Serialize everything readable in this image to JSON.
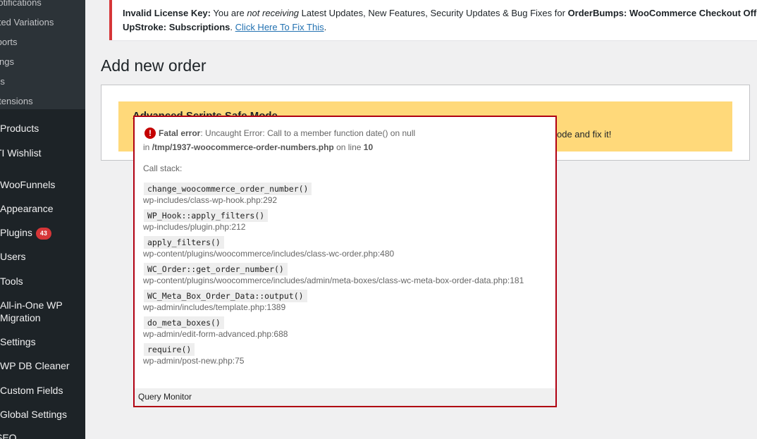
{
  "sidebar": {
    "submenu": [
      "Notifications",
      "Limited Variations",
      "Reports",
      "Settings",
      "Status",
      "Extensions"
    ],
    "menu": [
      {
        "label": "Products"
      },
      {
        "label": "TI Wishlist"
      },
      {
        "label": "WooFunnels"
      },
      {
        "label": "Appearance"
      },
      {
        "label": "Plugins",
        "badge": "43"
      },
      {
        "label": "Users"
      },
      {
        "label": "Tools"
      },
      {
        "label": "All-in-One WP",
        "label2": "Migration"
      },
      {
        "label": "Settings"
      },
      {
        "label": "WP DB Cleaner"
      },
      {
        "label": "Custom Fields"
      },
      {
        "label": "Global Settings"
      },
      {
        "label": "SEO"
      }
    ]
  },
  "license_notice": {
    "prefix": "Invalid License Key:",
    "text1": " You are ",
    "emphasis": "not receiving",
    "text2": " Latest Updates, New Features, Security Updates & Bug Fixes for ",
    "product1": "OrderBumps: WooCommerce Checkout Offers",
    "text3": ",",
    "product2": "UpStroke: Subscriptions",
    "text4": ". ",
    "link": "Click Here To Fix This",
    "text5": "."
  },
  "page_title": "Add new order",
  "yellow_notice": {
    "title": "Advanced Scripts Safe Mode",
    "text": "ode and fix it!"
  },
  "qm": {
    "error_label": "Fatal error",
    "error_message": ": Uncaught Error: Call to a member function date() on null",
    "in_text": "in ",
    "file": "/tmp/1937-woocommerce-order-numbers.php",
    "on_line_text": " on line ",
    "line": "10",
    "callstack_label": "Call stack:",
    "stack": [
      {
        "fn": "change_woocommerce_order_number()",
        "path": "wp-includes/class-wp-hook.php:292"
      },
      {
        "fn": "WP_Hook::apply_filters()",
        "path": "wp-includes/plugin.php:212"
      },
      {
        "fn": "apply_filters()",
        "path": "wp-content/plugins/woocommerce/includes/class-wc-order.php:480"
      },
      {
        "fn": "WC_Order::get_order_number()",
        "path": "wp-content/plugins/woocommerce/includes/admin/meta-boxes/class-wc-meta-box-order-data.php:181"
      },
      {
        "fn": "WC_Meta_Box_Order_Data::output()",
        "path": "wp-admin/includes/template.php:1389"
      },
      {
        "fn": "do_meta_boxes()",
        "path": "wp-admin/edit-form-advanced.php:688"
      },
      {
        "fn": "require()",
        "path": "wp-admin/post-new.php:75"
      }
    ],
    "footer": "Query Monitor"
  },
  "colors": {
    "sidebar_bg": "#1d2327",
    "submenu_bg": "#2c3338",
    "error_red": "#b00012",
    "notice_yellow": "#ffd97a",
    "link_blue": "#2271b1"
  }
}
